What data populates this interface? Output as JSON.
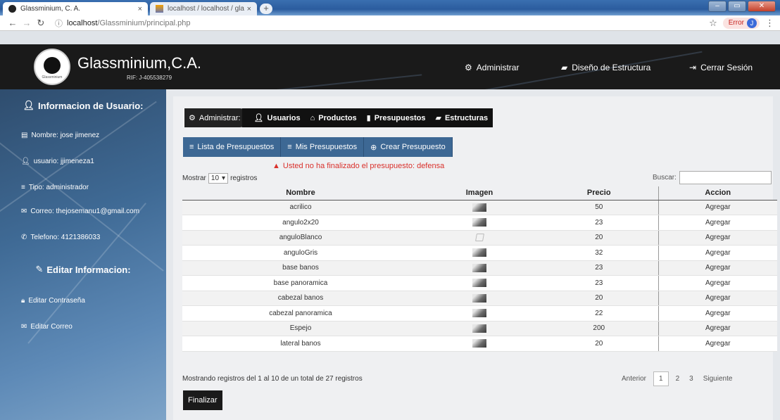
{
  "browser": {
    "tabs": [
      {
        "title": "Glassminium, C. A.",
        "close": "×"
      },
      {
        "title": "localhost / localhost / glassminiu",
        "close": "×"
      }
    ],
    "new_tab": "+",
    "url_prefix": "localhost",
    "url_path": "/Glassminium/principal.php",
    "error_label": "Error",
    "profile_initial": "J"
  },
  "header": {
    "brand": "Glassminium,C.A.",
    "rif": "RIF: J-405538279",
    "logo_text": "Glassminium",
    "nav": [
      {
        "icon": "⚙",
        "label": "Administrar"
      },
      {
        "icon": "▰",
        "label": "Diseño de Estructura"
      },
      {
        "icon": "⇥",
        "label": "Cerrar Sesión"
      }
    ]
  },
  "sidebar": {
    "user_info_title": "Informacion de Usuario:",
    "nombre": "Nombre: jose jimenez",
    "usuario": "usuario: jjimeneza1",
    "tipo": "Tipo: administrador",
    "correo": "Correo: thejosemanu1@gmail.com",
    "telefono": "Telefono: 4121386033",
    "edit_title": "Editar Informacion:",
    "editar_contrasena": "Editar Contraseña",
    "editar_correo": "Editar Correo"
  },
  "main": {
    "admin_tab": "Administrar:",
    "tabs": [
      "Usuarios",
      "Productos",
      "Presupuestos",
      "Estructuras"
    ],
    "subtabs": [
      "Lista de Presupuestos",
      "Mis Presupuestos",
      "Crear Presupuesto"
    ],
    "warning": "Usted no ha finalizado el presupuesto: defensa",
    "length_prefix": "Mostrar",
    "length_value": "10",
    "length_suffix": "registros",
    "search_label": "Buscar:",
    "search_value": "",
    "columns": [
      "Nombre",
      "Imagen",
      "Precio",
      "Accion"
    ],
    "rows": [
      {
        "nombre": "acrilico",
        "precio": "50",
        "accion": "Agregar",
        "broken": false
      },
      {
        "nombre": "angulo2x20",
        "precio": "23",
        "accion": "Agregar",
        "broken": false
      },
      {
        "nombre": "anguloBlanco",
        "precio": "20",
        "accion": "Agregar",
        "broken": true
      },
      {
        "nombre": "anguloGris",
        "precio": "32",
        "accion": "Agregar",
        "broken": false
      },
      {
        "nombre": "base banos",
        "precio": "23",
        "accion": "Agregar",
        "broken": false
      },
      {
        "nombre": "base panoramica",
        "precio": "23",
        "accion": "Agregar",
        "broken": false
      },
      {
        "nombre": "cabezal banos",
        "precio": "20",
        "accion": "Agregar",
        "broken": false
      },
      {
        "nombre": "cabezal panoramica",
        "precio": "22",
        "accion": "Agregar",
        "broken": false
      },
      {
        "nombre": "Espejo",
        "precio": "200",
        "accion": "Agregar",
        "broken": false
      },
      {
        "nombre": "lateral banos",
        "precio": "20",
        "accion": "Agregar",
        "broken": false
      }
    ],
    "info": "Mostrando registros del 1 al 10 de un total de 27 registros",
    "pager": {
      "prev": "Anterior",
      "pages": [
        "1",
        "2",
        "3"
      ],
      "next": "Siguiente"
    },
    "finalizar": "Finalizar"
  }
}
